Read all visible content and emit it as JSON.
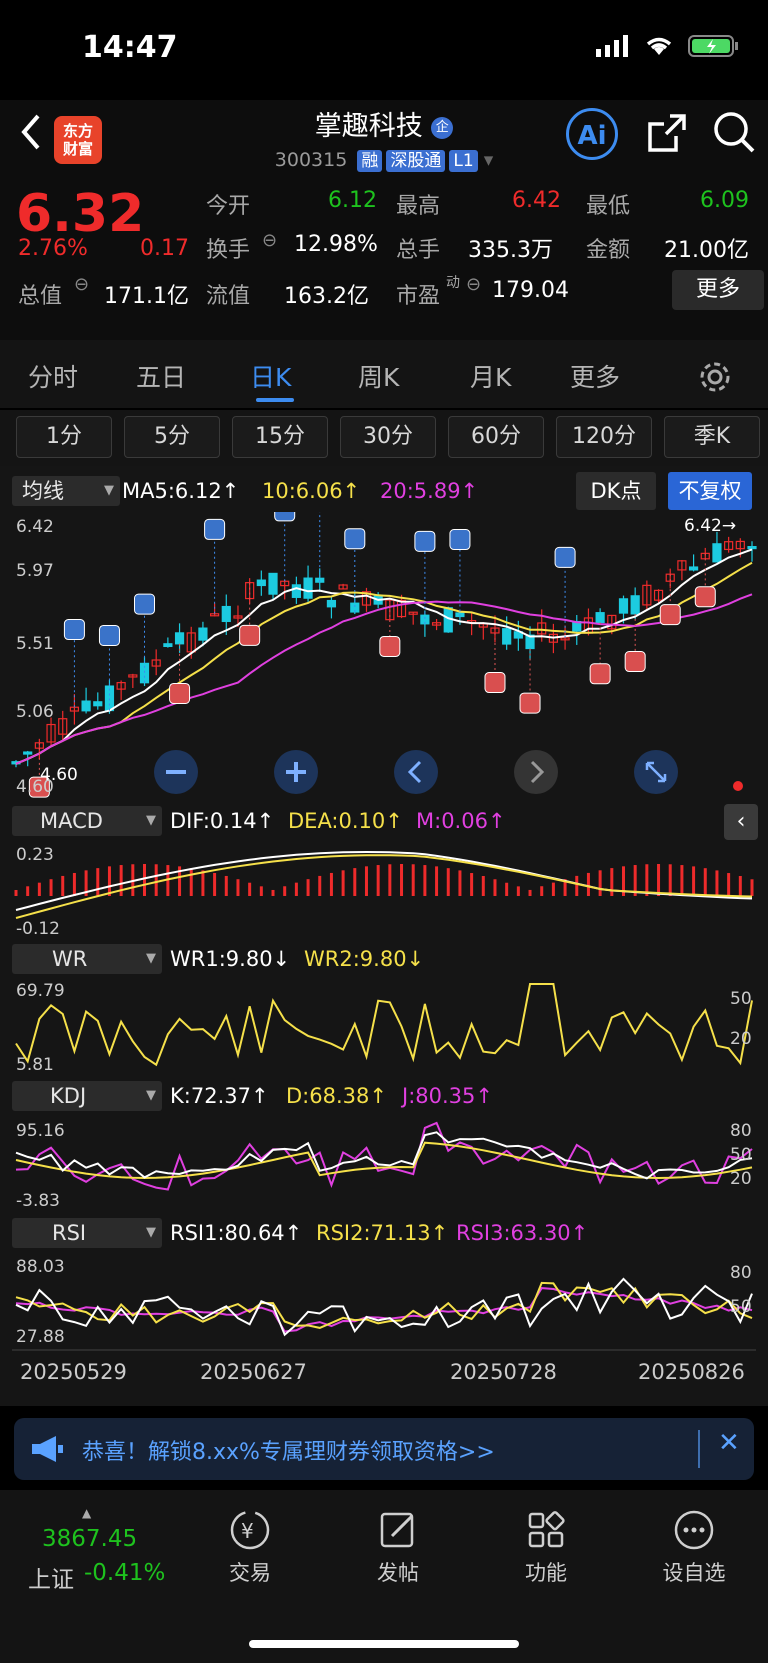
{
  "status": {
    "time": "14:47"
  },
  "header": {
    "logo_text": "东方财富",
    "title": "掌趣科技",
    "title_badge": "企",
    "code": "300315",
    "tags": [
      "融",
      "深股通",
      "L1"
    ],
    "ai_label": "Ai"
  },
  "quote": {
    "price": "6.32",
    "pct": "2.76%",
    "change": "0.17",
    "rows": [
      [
        {
          "label": "今开",
          "value": "6.12",
          "color": "green"
        },
        {
          "label": "最高",
          "value": "6.42",
          "color": "red"
        },
        {
          "label": "最低",
          "value": "6.09",
          "color": "green"
        }
      ],
      [
        {
          "label": "换手",
          "value": "12.98%",
          "color": "white"
        },
        {
          "label": "总手",
          "value": "335.3万",
          "color": "white"
        },
        {
          "label": "金额",
          "value": "21.00亿",
          "color": "white"
        }
      ]
    ],
    "total_value_label": "总值",
    "total_value": "171.1亿",
    "float_label": "流值",
    "float_value": "163.2亿",
    "pe_label": "市盈",
    "pe_sup": "动",
    "pe_value": "179.04",
    "more": "更多"
  },
  "tabs": [
    "分时",
    "五日",
    "日K",
    "周K",
    "月K",
    "更多"
  ],
  "active_tab": "日K",
  "periods": [
    "1分",
    "5分",
    "15分",
    "30分",
    "60分",
    "120分",
    "季K"
  ],
  "main_chart": {
    "indicator": "均线",
    "ma5": "MA5:6.12↑",
    "ma10": "10:6.06↑",
    "ma20": "20:5.89↑",
    "dk_btn": "DK点",
    "fq_btn": "不复权",
    "y_labels": [
      "6.42",
      "5.97",
      "5.51",
      "5.06",
      "4.60"
    ],
    "high_marker": "6.42→",
    "low_marker": "4.60"
  },
  "macd": {
    "name": "MACD",
    "dif": "DIF:0.14↑",
    "dea": "DEA:0.10↑",
    "m": "M:0.06↑",
    "y_top": "0.23",
    "y_bot": "-0.12"
  },
  "wr": {
    "name": "WR",
    "wr1": "WR1:9.80↓",
    "wr2": "WR2:9.80↓",
    "y_top": "69.79",
    "y_bot": "5.81",
    "r1": "50",
    "r2": "20"
  },
  "kdj": {
    "name": "KDJ",
    "k": "K:72.37↑",
    "d": "D:68.38↑",
    "j": "J:80.35↑",
    "y_top": "95.16",
    "y_bot": "-3.83",
    "r1": "80",
    "r2": "50",
    "r3": "20"
  },
  "rsi": {
    "name": "RSI",
    "r1": "RSI1:80.64↑",
    "r2": "RSI2:71.13↑",
    "r3": "RSI3:63.30↑",
    "y_top": "88.03",
    "y_bot": "27.88",
    "ra": "80",
    "rb": "50"
  },
  "dates": [
    "20250529",
    "20250627",
    "20250728",
    "20250826"
  ],
  "ad": {
    "text": "恭喜！解锁8.xx%专属理财券领取资格>>"
  },
  "tabbar": {
    "index_value": "3867.45",
    "index_name": "上证",
    "index_pct": "-0.41%",
    "items": [
      "交易",
      "发帖",
      "功能",
      "设自选"
    ]
  },
  "colors": {
    "up": "#ef2b2b",
    "down": "#1ec21e",
    "ma5": "#ffffff",
    "ma10": "#f5e04a",
    "ma20": "#e040e0",
    "accent": "#3d8cf0"
  }
}
